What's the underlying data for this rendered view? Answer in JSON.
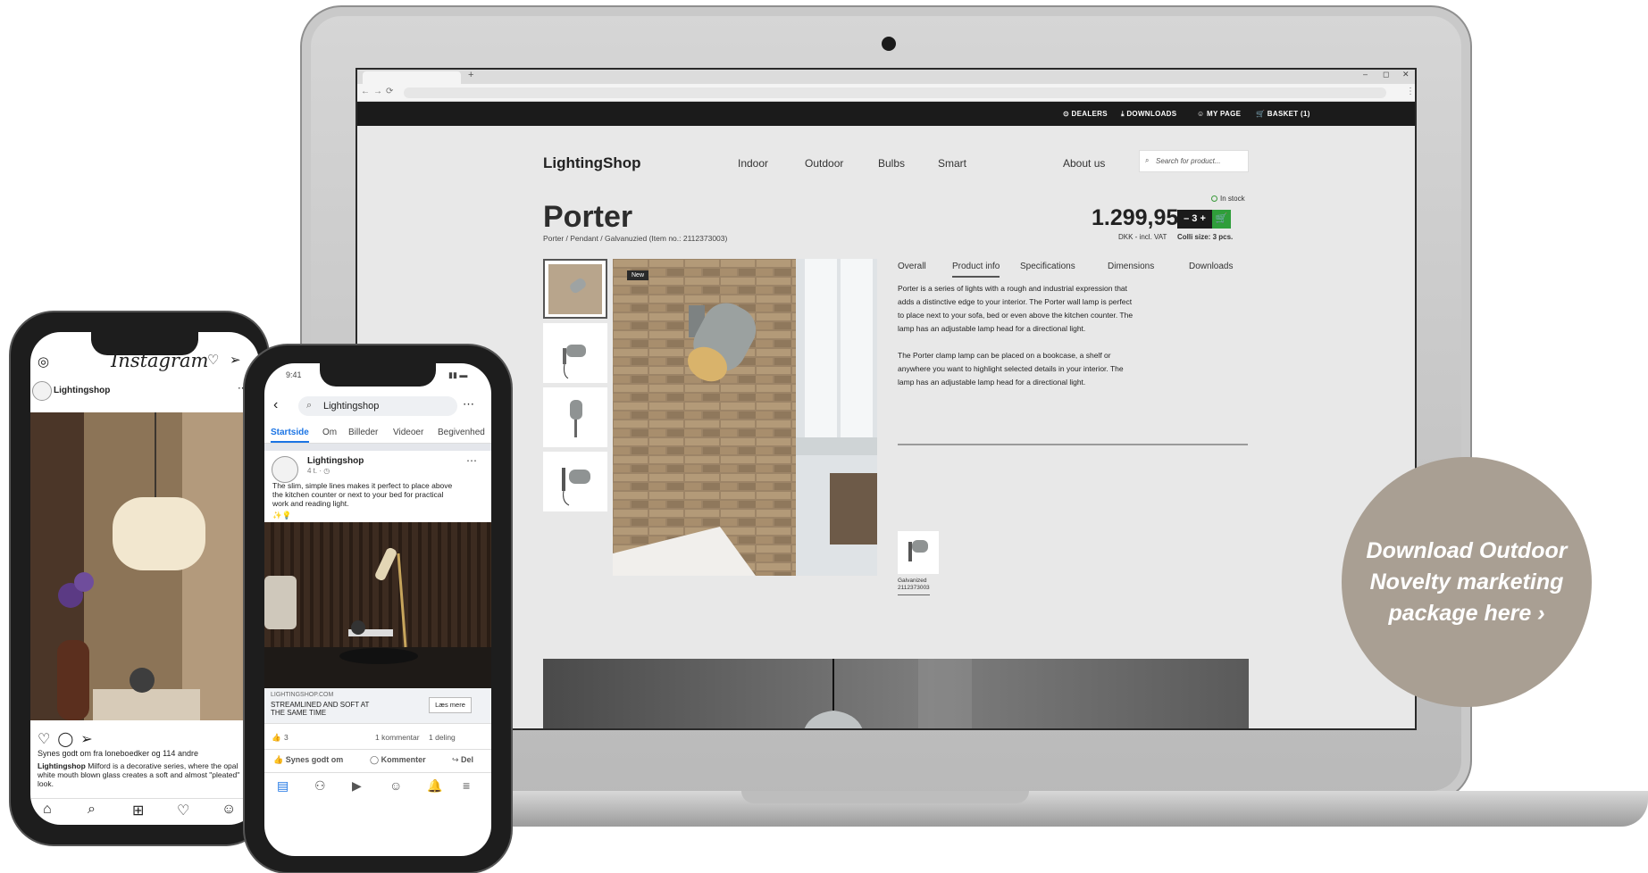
{
  "browser": {
    "new_tab": "+",
    "minimize": "–",
    "restore": "◻",
    "close": "✕",
    "back": "←",
    "forward": "→",
    "reload": "⟳",
    "more": "⋮"
  },
  "topbar": {
    "dealers": "DEALERS",
    "downloads": "DOWNLOADS",
    "my_page": "MY PAGE",
    "basket": "BASKET (1)"
  },
  "site": {
    "logo": "LightingShop",
    "nav": [
      "Indoor",
      "Outdoor",
      "Bulbs",
      "Smart",
      "About us"
    ],
    "search_placeholder": "Search for product..."
  },
  "product": {
    "title": "Porter",
    "breadcrumb": "Porter / Pendant / Galvanuzied (Item no.: 2112373003)",
    "stock": "In stock",
    "price": "1.299,95",
    "vat": "DKK - incl. VAT",
    "quantity": "– 3 +",
    "colli": "Colli size: 3 pcs.",
    "badge": "New",
    "tabs": [
      "Overall",
      "Product info",
      "Specifications",
      "Dimensions",
      "Downloads"
    ],
    "active_tab": "Product info",
    "description_1": "Porter is a series of lights with a rough and industrial expression that adds a distinctive edge to your interior. The Porter wall lamp is perfect to place next to your sofa, bed or even above the kitchen counter. The lamp has an adjustable lamp head for a directional light.",
    "description_2": "The Porter clamp lamp can be placed on a bookcase, a shelf or anywhere you want to highlight selected details in your interior. The lamp has an adjustable lamp head for a directional light.",
    "variant_name": "Galvanized",
    "variant_number": "2112373003"
  },
  "cta": {
    "text": "Download Outdoor Novelty marketing package here ›"
  },
  "instagram": {
    "logo": "Instagram",
    "username": "Lightingshop",
    "likes": "Synes godt om fra loneboedker og 114 andre",
    "caption_user": "Lightingshop",
    "caption_text": "Milford is a decorative series, where the opal white mouth blown glass creates a soft and almost \"pleated\" look."
  },
  "facebook": {
    "time": "9:41",
    "search_value": "Lightingshop",
    "tabs": [
      "Startside",
      "Om",
      "Billeder",
      "Videoer",
      "Begivenhed"
    ],
    "page_name": "Lightingshop",
    "post_meta": "4 t. · ◷",
    "post_text": "The slim, simple lines makes it perfect to place above the kitchen counter or next to your bed for practical work and reading light.",
    "post_emoji": "✨💡",
    "link_domain": "LIGHTINGSHOP.COM",
    "link_title": "STREAMLINED AND SOFT AT THE SAME TIME",
    "link_button": "Læs mere",
    "reactions": "3",
    "comments": "1 kommentar",
    "shares": "1 deling",
    "action_like": "Synes godt om",
    "action_comment": "Kommenter",
    "action_share": "Del"
  }
}
